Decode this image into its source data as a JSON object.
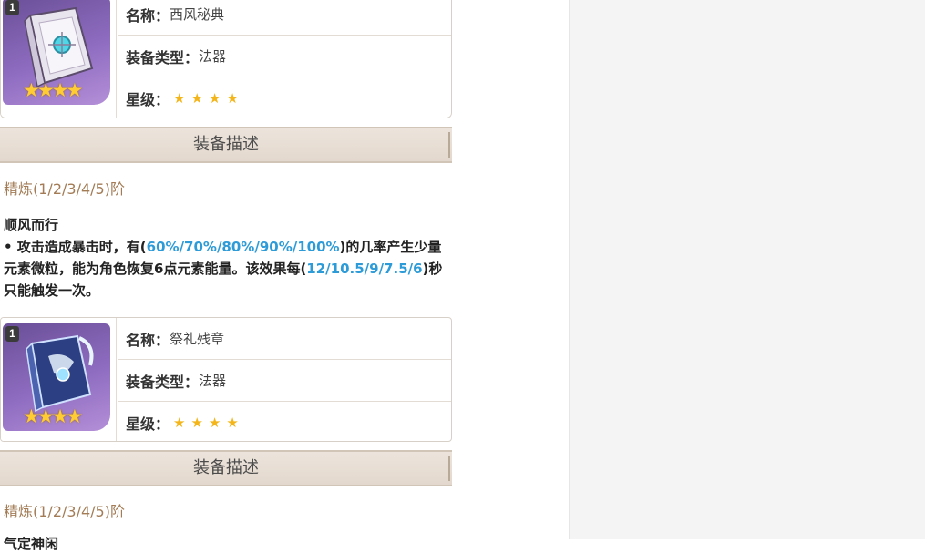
{
  "weapons": [
    {
      "level_badge": "1",
      "name_label": "名称：",
      "name_value": "西风秘典",
      "type_label": "装备类型：",
      "type_value": "法器",
      "rarity_label": "星级：",
      "rarity_stars": "★★★★",
      "rarity": 4,
      "icon": "book-icon",
      "icon_stars": "★★★★",
      "section_title": "装备描述",
      "refine_text": "精炼(1/2/3/4/5)阶",
      "skill_name": "顺风而行",
      "skill_parts": [
        "• 攻击造成暴击时，有(",
        "60%/70%/80%/90%/100%",
        ")的几率产生少量元素微粒，能为角色恢复6点元素能量。该效果每(",
        "12/10.5/9/7.5/6",
        ")秒只能触发一次。"
      ]
    },
    {
      "level_badge": "1",
      "name_label": "名称：",
      "name_value": "祭礼残章",
      "type_label": "装备类型：",
      "type_value": "法器",
      "rarity_label": "星级：",
      "rarity_stars": "★★★★",
      "rarity": 4,
      "icon": "book-icon",
      "icon_stars": "★★★★",
      "section_title": "装备描述",
      "refine_text": "精炼(1/2/3/4/5)阶",
      "skill_name": "气定神闲"
    }
  ],
  "colors": {
    "highlight": "#2d9bd8",
    "refine": "#a37c56",
    "star": "#f3b519"
  }
}
